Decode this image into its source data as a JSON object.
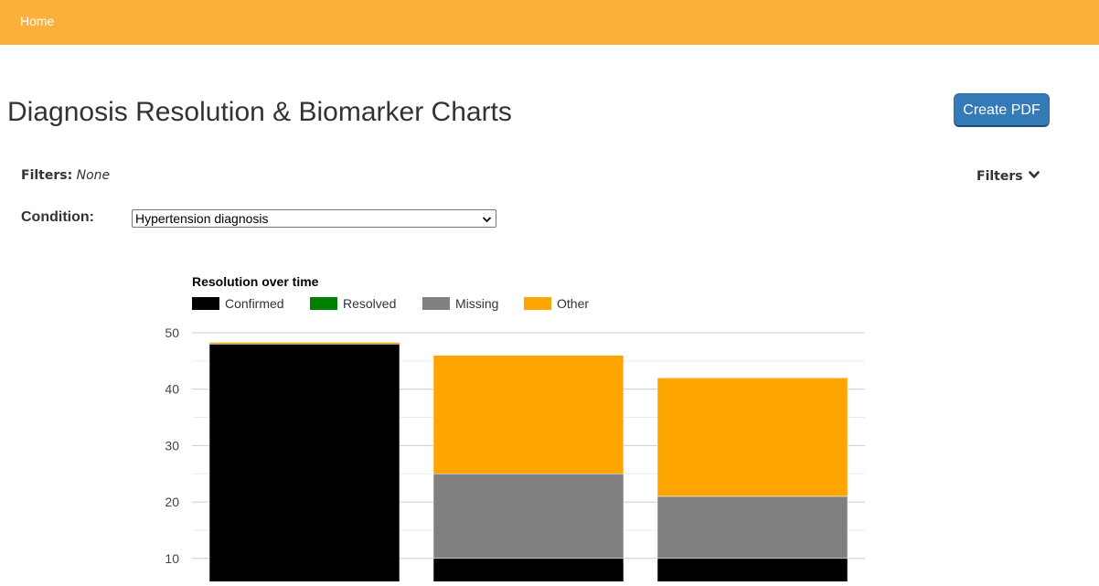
{
  "nav": {
    "home_label": "Home",
    "bar_color": "#FBB03B"
  },
  "page": {
    "title": "Diagnosis Resolution & Biomarker Charts",
    "create_pdf_label": "Create PDF"
  },
  "filters": {
    "label": "Filters:",
    "value": "None",
    "toggle_label": "Filters",
    "toggle_icon": "chevron-down-icon"
  },
  "condition": {
    "label": "Condition:",
    "selected": "Hypertension diagnosis"
  },
  "chart_data": {
    "type": "bar",
    "stacked": true,
    "title": "Resolution over time",
    "legend_position": "top-left",
    "grid": true,
    "ylim": [
      0,
      50
    ],
    "yticks": [
      10,
      20,
      30,
      40,
      50
    ],
    "categories": [
      "",
      "",
      ""
    ],
    "series": [
      {
        "name": "Confirmed",
        "color": "#000000",
        "values": [
          48,
          10,
          10
        ]
      },
      {
        "name": "Resolved",
        "color": "#008000",
        "values": [
          0,
          0,
          0
        ]
      },
      {
        "name": "Missing",
        "color": "#808080",
        "values": [
          0,
          15,
          11
        ]
      },
      {
        "name": "Other",
        "color": "#FFA500",
        "values": [
          0.3,
          21,
          21
        ]
      }
    ]
  }
}
